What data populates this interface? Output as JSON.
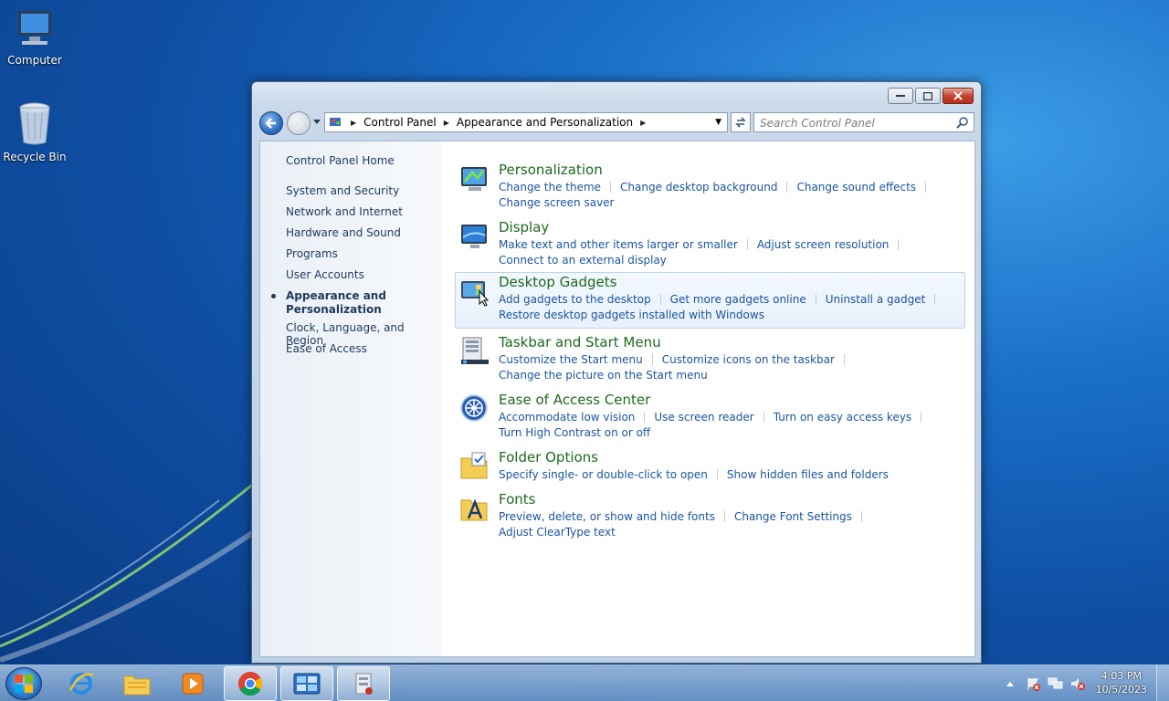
{
  "desktop": {
    "icons": [
      {
        "label": "Computer"
      },
      {
        "label": "Recycle Bin"
      }
    ]
  },
  "address": {
    "crumbs": [
      "Control Panel",
      "Appearance and Personalization"
    ],
    "search_placeholder": "Search Control Panel"
  },
  "sidebar": {
    "home": "Control Panel Home",
    "items": [
      "System and Security",
      "Network and Internet",
      "Hardware and Sound",
      "Programs",
      "User Accounts",
      "Appearance and Personalization",
      "Clock, Language, and Region",
      "Ease of Access"
    ],
    "current_line1": "Appearance and",
    "current_line2": "Personalization"
  },
  "categories": [
    {
      "title": "Personalization",
      "links": [
        "Change the theme",
        "Change desktop background",
        "Change sound effects",
        "Change screen saver"
      ]
    },
    {
      "title": "Display",
      "links": [
        "Make text and other items larger or smaller",
        "Adjust screen resolution",
        "Connect to an external display"
      ]
    },
    {
      "title": "Desktop Gadgets",
      "links": [
        "Add gadgets to the desktop",
        "Get more gadgets online",
        "Uninstall a gadget",
        "Restore desktop gadgets installed with Windows"
      ]
    },
    {
      "title": "Taskbar and Start Menu",
      "links": [
        "Customize the Start menu",
        "Customize icons on the taskbar",
        "Change the picture on the Start menu"
      ]
    },
    {
      "title": "Ease of Access Center",
      "links": [
        "Accommodate low vision",
        "Use screen reader",
        "Turn on easy access keys",
        "Turn High Contrast on or off"
      ]
    },
    {
      "title": "Folder Options",
      "links": [
        "Specify single- or double-click to open",
        "Show hidden files and folders"
      ]
    },
    {
      "title": "Fonts",
      "links": [
        "Preview, delete, or show and hide fonts",
        "Change Font Settings",
        "Adjust ClearType text"
      ]
    }
  ],
  "clock": {
    "time": "4:03 PM",
    "date": "10/5/2023"
  },
  "colors": {
    "link": "#1a55a0",
    "category_title": "#1e6a1e",
    "nav_text": "#1e3a5c"
  }
}
